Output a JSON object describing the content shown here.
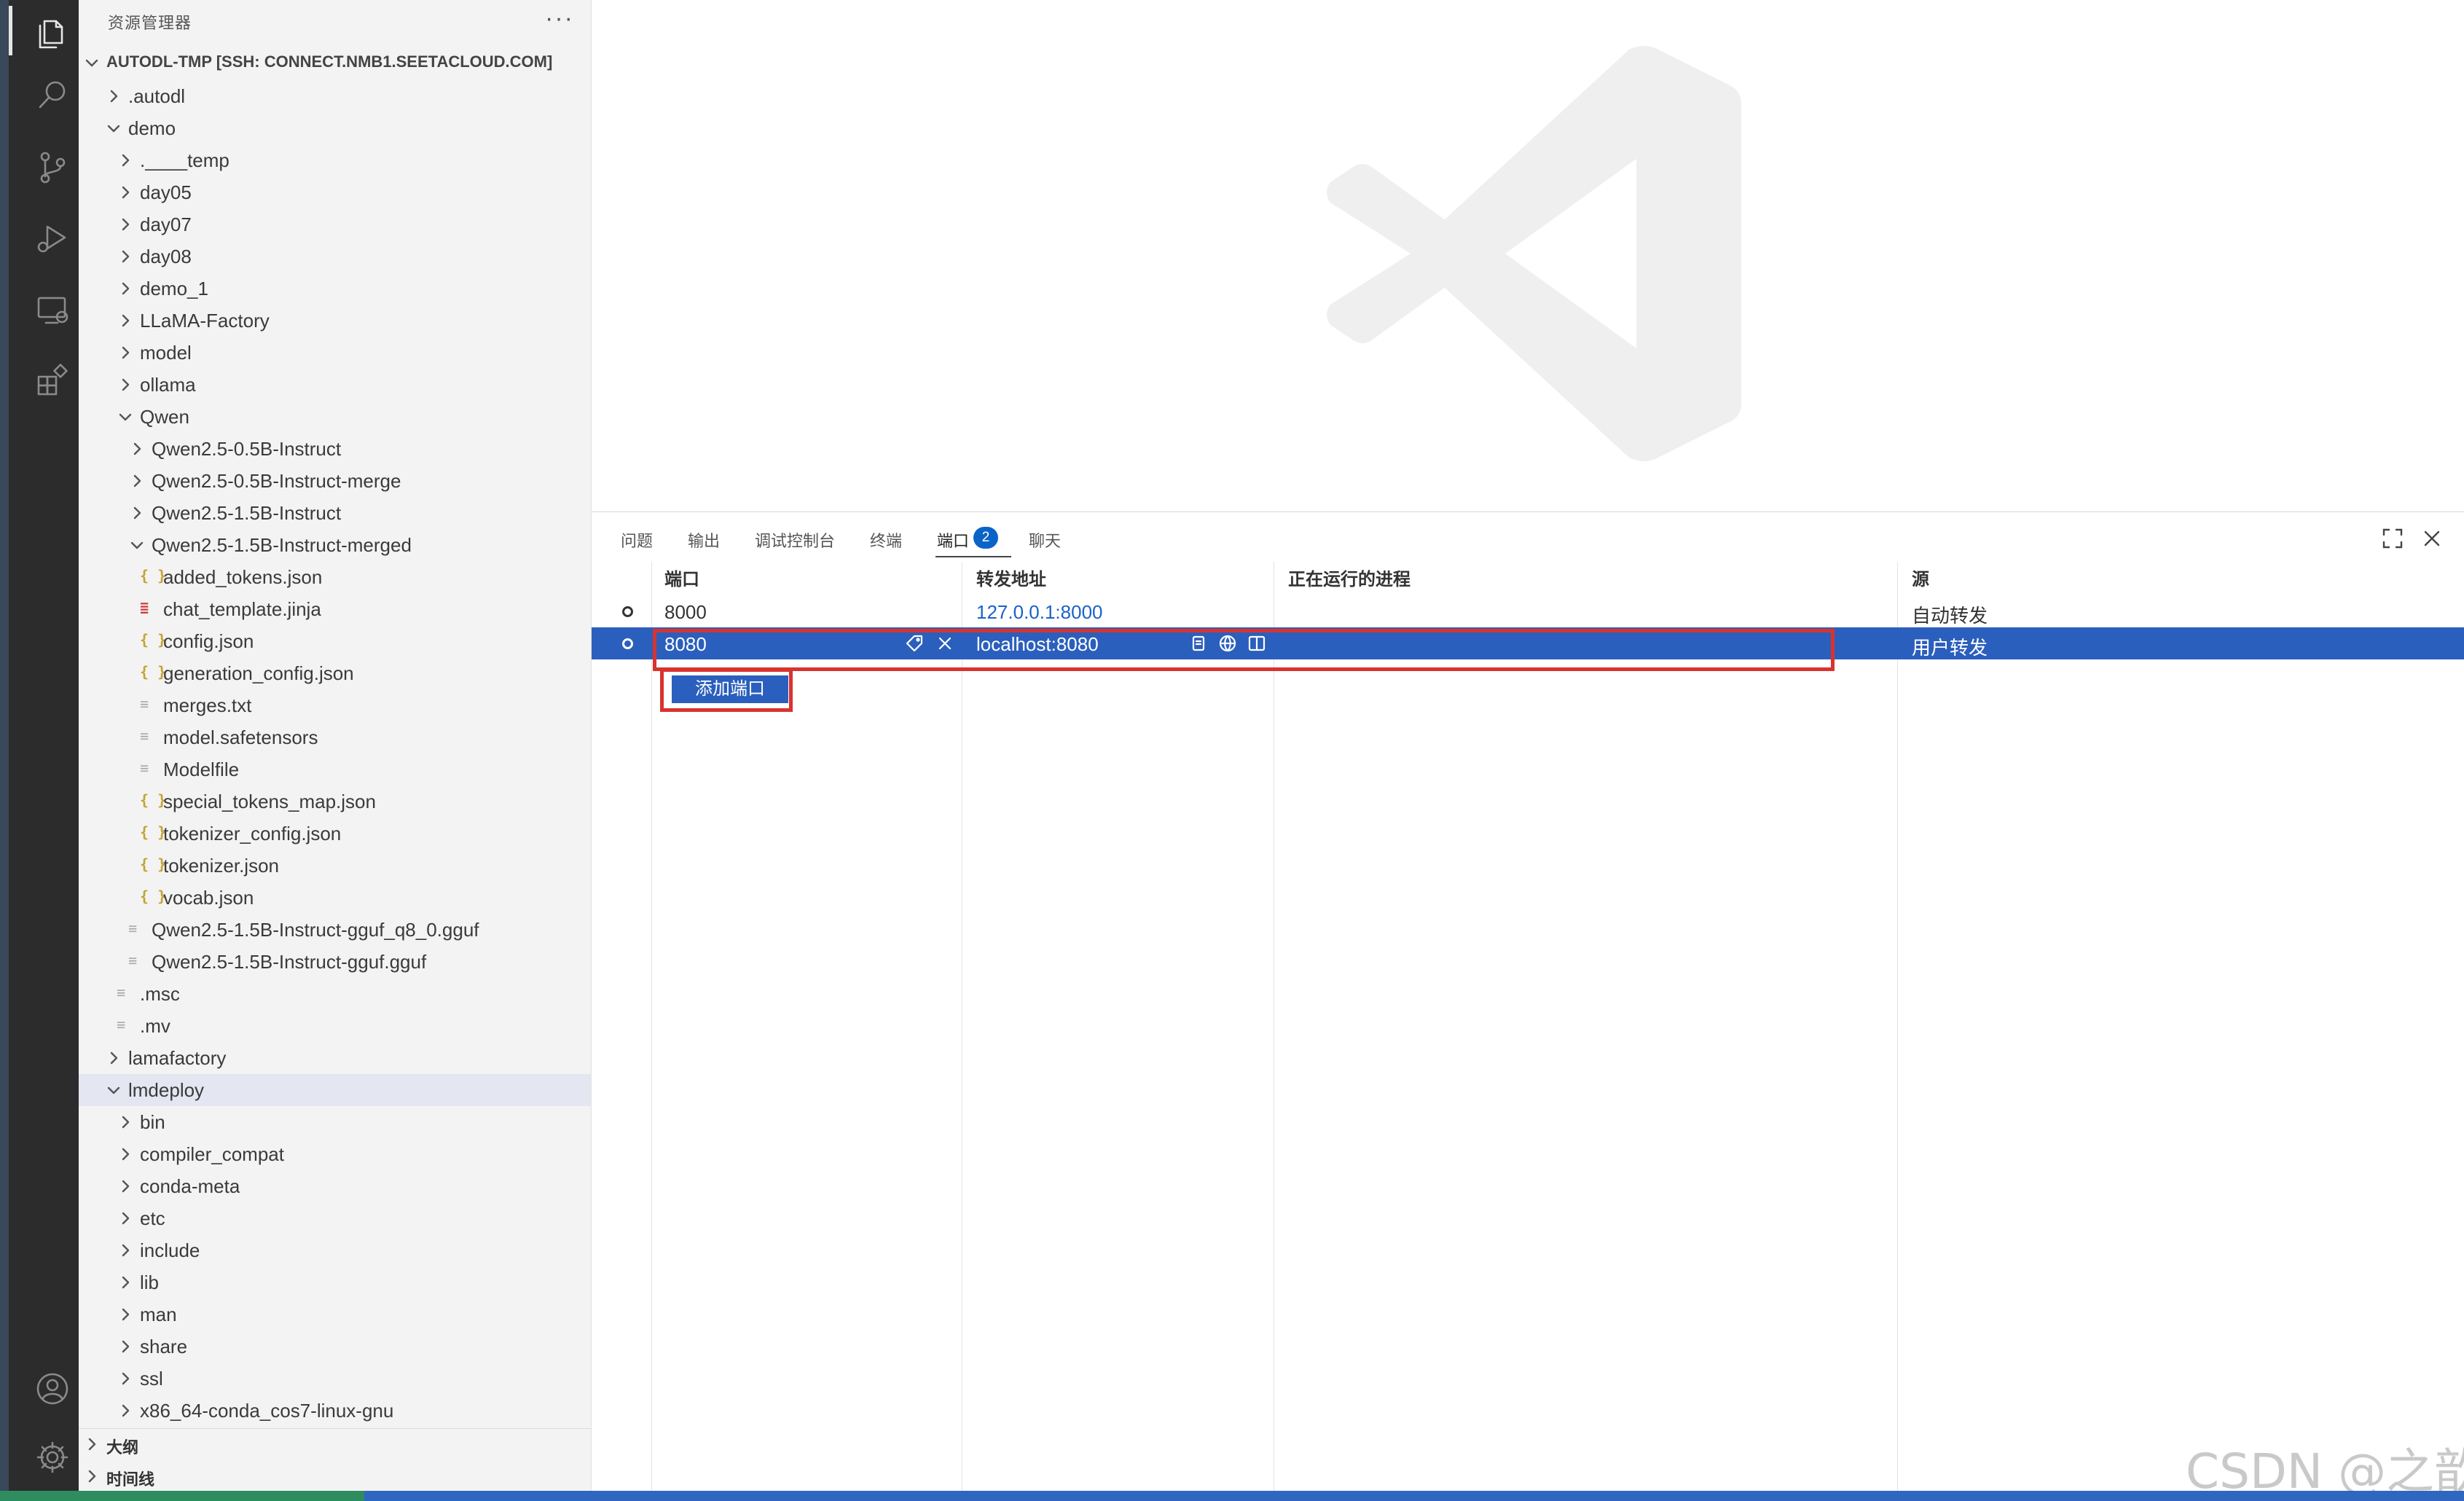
{
  "sidebar": {
    "title": "资源管理器",
    "more": "···",
    "root": "AUTODL-TMP [SSH: CONNECT.NMB1.SEETACLOUD.COM]",
    "items": [
      {
        "label": ".autodl",
        "type": "folder",
        "state": "collapsed",
        "depth": 1
      },
      {
        "label": "demo",
        "type": "folder",
        "state": "expanded",
        "depth": 1
      },
      {
        "label": ".____temp",
        "type": "folder",
        "state": "collapsed",
        "depth": 2
      },
      {
        "label": "day05",
        "type": "folder",
        "state": "collapsed",
        "depth": 2
      },
      {
        "label": "day07",
        "type": "folder",
        "state": "collapsed",
        "depth": 2
      },
      {
        "label": "day08",
        "type": "folder",
        "state": "collapsed",
        "depth": 2
      },
      {
        "label": "demo_1",
        "type": "folder",
        "state": "collapsed",
        "depth": 2
      },
      {
        "label": "LLaMA-Factory",
        "type": "folder",
        "state": "collapsed",
        "depth": 2
      },
      {
        "label": "model",
        "type": "folder",
        "state": "collapsed",
        "depth": 2
      },
      {
        "label": "ollama",
        "type": "folder",
        "state": "collapsed",
        "depth": 2
      },
      {
        "label": "Qwen",
        "type": "folder",
        "state": "expanded",
        "depth": 2
      },
      {
        "label": "Qwen2.5-0.5B-Instruct",
        "type": "folder",
        "state": "collapsed",
        "depth": 3
      },
      {
        "label": "Qwen2.5-0.5B-Instruct-merge",
        "type": "folder",
        "state": "collapsed",
        "depth": 3
      },
      {
        "label": "Qwen2.5-1.5B-Instruct",
        "type": "folder",
        "state": "collapsed",
        "depth": 3
      },
      {
        "label": "Qwen2.5-1.5B-Instruct-merged",
        "type": "folder",
        "state": "expanded",
        "depth": 3
      },
      {
        "label": "added_tokens.json",
        "type": "json",
        "depth": 4
      },
      {
        "label": "chat_template.jinja",
        "type": "jinja",
        "depth": 4
      },
      {
        "label": "config.json",
        "type": "json",
        "depth": 4
      },
      {
        "label": "generation_config.json",
        "type": "json",
        "depth": 4
      },
      {
        "label": "merges.txt",
        "type": "text",
        "depth": 4
      },
      {
        "label": "model.safetensors",
        "type": "text",
        "depth": 4
      },
      {
        "label": "Modelfile",
        "type": "text",
        "depth": 4
      },
      {
        "label": "special_tokens_map.json",
        "type": "json",
        "depth": 4
      },
      {
        "label": "tokenizer_config.json",
        "type": "json",
        "depth": 4
      },
      {
        "label": "tokenizer.json",
        "type": "json",
        "depth": 4
      },
      {
        "label": "vocab.json",
        "type": "json",
        "depth": 4
      },
      {
        "label": "Qwen2.5-1.5B-Instruct-gguf_q8_0.gguf",
        "type": "text",
        "depth": 3
      },
      {
        "label": "Qwen2.5-1.5B-Instruct-gguf.gguf",
        "type": "text",
        "depth": 3
      },
      {
        "label": ".msc",
        "type": "text",
        "depth": 2
      },
      {
        "label": ".mv",
        "type": "text",
        "depth": 2
      },
      {
        "label": "lamafactory",
        "type": "folder",
        "state": "collapsed",
        "depth": 1
      },
      {
        "label": "lmdeploy",
        "type": "folder",
        "state": "expanded",
        "depth": 1,
        "selected": true
      },
      {
        "label": "bin",
        "type": "folder",
        "state": "collapsed",
        "depth": 2
      },
      {
        "label": "compiler_compat",
        "type": "folder",
        "state": "collapsed",
        "depth": 2
      },
      {
        "label": "conda-meta",
        "type": "folder",
        "state": "collapsed",
        "depth": 2
      },
      {
        "label": "etc",
        "type": "folder",
        "state": "collapsed",
        "depth": 2
      },
      {
        "label": "include",
        "type": "folder",
        "state": "collapsed",
        "depth": 2
      },
      {
        "label": "lib",
        "type": "folder",
        "state": "collapsed",
        "depth": 2
      },
      {
        "label": "man",
        "type": "folder",
        "state": "collapsed",
        "depth": 2
      },
      {
        "label": "share",
        "type": "folder",
        "state": "collapsed",
        "depth": 2
      },
      {
        "label": "ssl",
        "type": "folder",
        "state": "collapsed",
        "depth": 2
      },
      {
        "label": "x86_64-conda_cos7-linux-gnu",
        "type": "folder",
        "state": "collapsed",
        "depth": 2
      }
    ],
    "outline": "大纲",
    "timeline": "时间线"
  },
  "panel": {
    "tabs": [
      {
        "label": "问题"
      },
      {
        "label": "输出"
      },
      {
        "label": "调试控制台"
      },
      {
        "label": "终端"
      },
      {
        "label": "端口",
        "active": true,
        "badge": "2"
      },
      {
        "label": "聊天"
      }
    ],
    "columns": [
      "端口",
      "转发地址",
      "正在运行的进程",
      "源"
    ],
    "rows": [
      {
        "port": "8000",
        "address": "127.0.0.1:8000",
        "process": "",
        "source": "自动转发",
        "selected": false
      },
      {
        "port": "8080",
        "address": "localhost:8080",
        "process": "",
        "source": "用户转发",
        "selected": true
      }
    ],
    "add_port": "添加端口"
  },
  "watermark": "CSDN @之歆",
  "colors": {
    "accent": "#2b5fbd",
    "highlight": "#d9332f",
    "activity_bar": "#2c2c2c",
    "sidebar_bg": "#f3f3f3",
    "badge": "#0a64c8"
  }
}
